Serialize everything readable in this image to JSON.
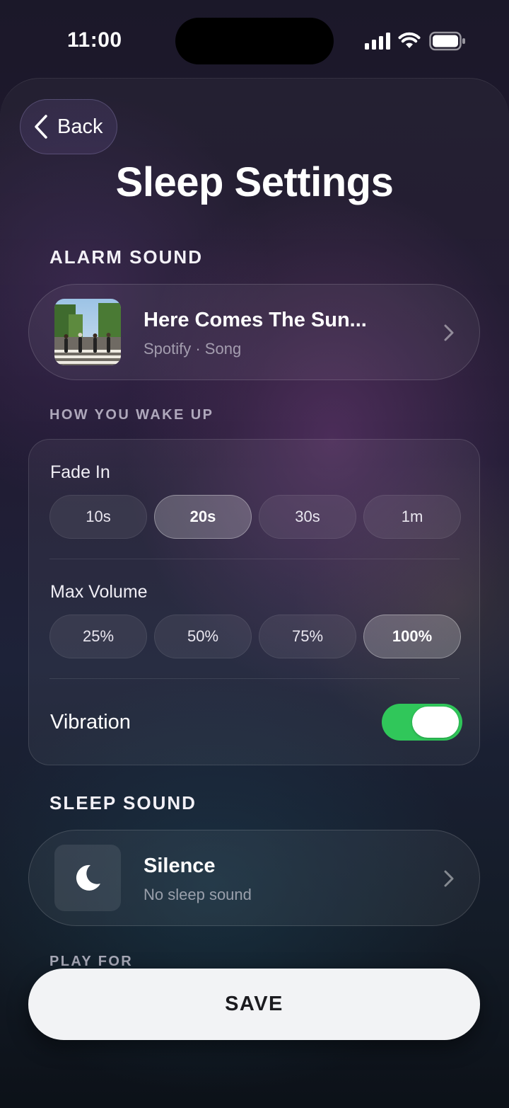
{
  "status_bar": {
    "time": "11:00",
    "icons": [
      "cellular-signal-icon",
      "wifi-icon",
      "battery-icon"
    ]
  },
  "nav": {
    "back_label": "Back",
    "back_icon": "chevron-left-icon"
  },
  "page_title": "Sleep Settings",
  "alarm_sound": {
    "section_title": "ALARM SOUND",
    "track_title": "Here Comes The Sun...",
    "track_subtitle": "Spotify · Song",
    "artwork": "album-artwork",
    "chevron_icon": "chevron-right-icon"
  },
  "wake": {
    "section_title": "HOW YOU WAKE UP",
    "fade_in": {
      "label": "Fade In",
      "options": [
        "10s",
        "20s",
        "30s",
        "1m"
      ],
      "selected": "20s"
    },
    "max_volume": {
      "label": "Max Volume",
      "options": [
        "25%",
        "50%",
        "75%",
        "100%"
      ],
      "selected": "100%"
    },
    "vibration": {
      "label": "Vibration",
      "enabled": true
    }
  },
  "sleep_sound": {
    "section_title": "SLEEP SOUND",
    "title": "Silence",
    "subtitle": "No sleep sound",
    "icon": "moon-icon",
    "chevron_icon": "chevron-right-icon"
  },
  "play_for": {
    "section_title": "PLAY FOR"
  },
  "save_label": "SAVE",
  "colors": {
    "toggle_on": "#30c75a",
    "save_bg": "#f2f3f5",
    "background_top": "#1b1829",
    "background_bottom": "#0c1118"
  }
}
